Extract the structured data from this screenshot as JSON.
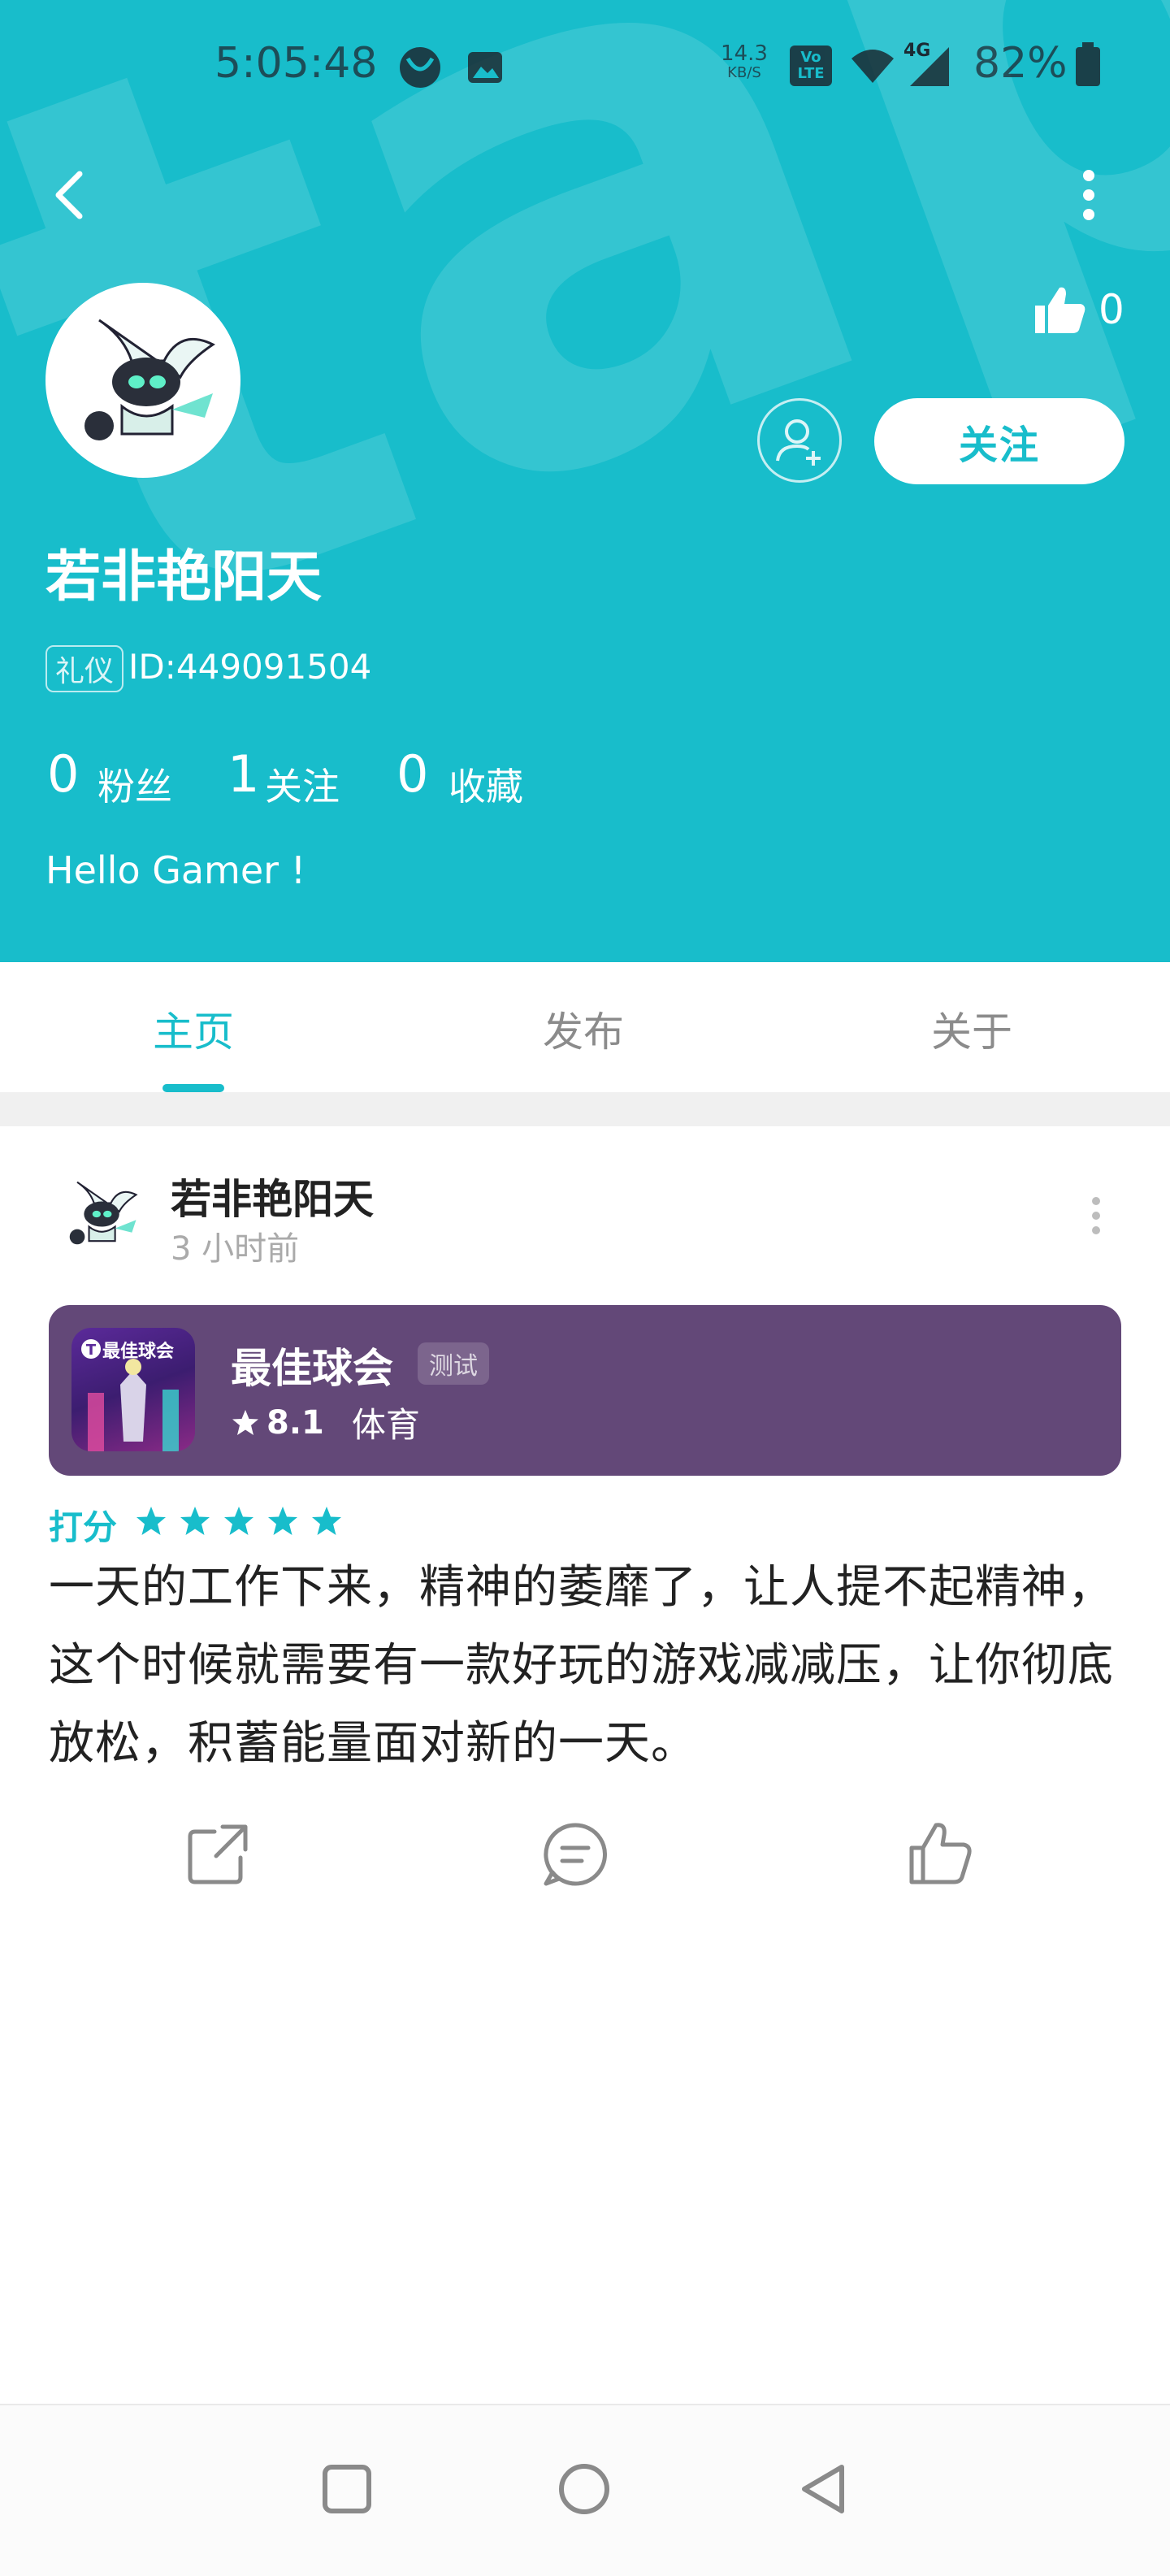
{
  "status_bar": {
    "time": "5:05:48",
    "net_speed_value": "14.3",
    "net_speed_unit": "KB/S",
    "volte": "Vo LTE",
    "network": "4G",
    "battery": "82%"
  },
  "header": {
    "likes": "0",
    "follow_label": "关注",
    "username": "若非艳阳天",
    "badge": "礼仪",
    "user_id": "ID:449091504",
    "stats": [
      {
        "num": "0",
        "label": "粉丝"
      },
      {
        "num": "1",
        "label": "关注"
      },
      {
        "num": "0",
        "label": "收藏"
      }
    ],
    "bio": "Hello Gamer !",
    "watermark": "tapta"
  },
  "tabs": [
    {
      "label": "主页",
      "active": true
    },
    {
      "label": "发布",
      "active": false
    },
    {
      "label": "关于",
      "active": false
    }
  ],
  "post": {
    "author": "若非艳阳天",
    "time": "3 小时前",
    "game": {
      "name": "最佳球会",
      "tag": "测试",
      "rating": "8.1",
      "category": "体育",
      "icon_text": "最佳球会",
      "icon_letter": "T"
    },
    "rating_label": "打分",
    "stars": 5,
    "content": "一天的工作下来，精神的萎靡了，让人提不起精神，这个时候就需要有一款好玩的游戏减减压，让你彻底放松，积蓄能量面对新的一天。"
  },
  "colors": {
    "accent": "#18bdcb",
    "card": "#634878"
  }
}
